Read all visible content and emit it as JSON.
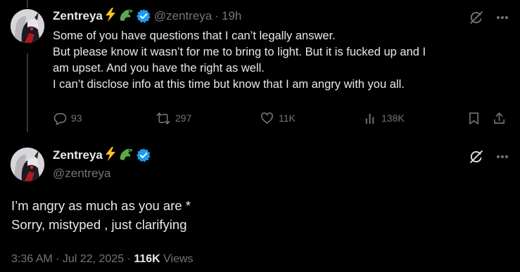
{
  "first_tweet": {
    "display_name": "Zentreya",
    "handle": "@zentreya",
    "separator": "·",
    "time": "19h",
    "lines": [
      "Some of you have questions that I can’t legally answer.",
      "But please know it wasn’t for me to bring to light. But it is fucked up and I",
      "am upset. And you have the right as well.",
      "I can’t disclose info at this time but know that I am angry with you all."
    ],
    "replies": "93",
    "reposts": "297",
    "likes": "11K",
    "views": "138K"
  },
  "second_tweet": {
    "display_name": "Zentreya",
    "handle": "@zentreya",
    "lines": [
      "I’m angry as much as you are *",
      "Sorry, mistyped , just clarifying"
    ],
    "timestamp": "3:36 AM · Jul 22, 2025 ·",
    "views_count": "116K",
    "views_label": "Views"
  },
  "colors": {
    "background": "#000000",
    "text": "#e7e9ea",
    "muted": "#71767b",
    "verified": "#1d9bf0",
    "thread_line": "#333639"
  },
  "icons": {
    "bolt": "lightning-emoji",
    "croc": "crocodile-emoji",
    "verified": "verified-badge-icon",
    "grok": "grok-icon",
    "more": "more-icon",
    "reply": "reply-icon",
    "repost": "repost-icon",
    "like": "heart-icon",
    "views": "views-chart-icon",
    "bookmark": "bookmark-icon",
    "share": "share-icon"
  }
}
